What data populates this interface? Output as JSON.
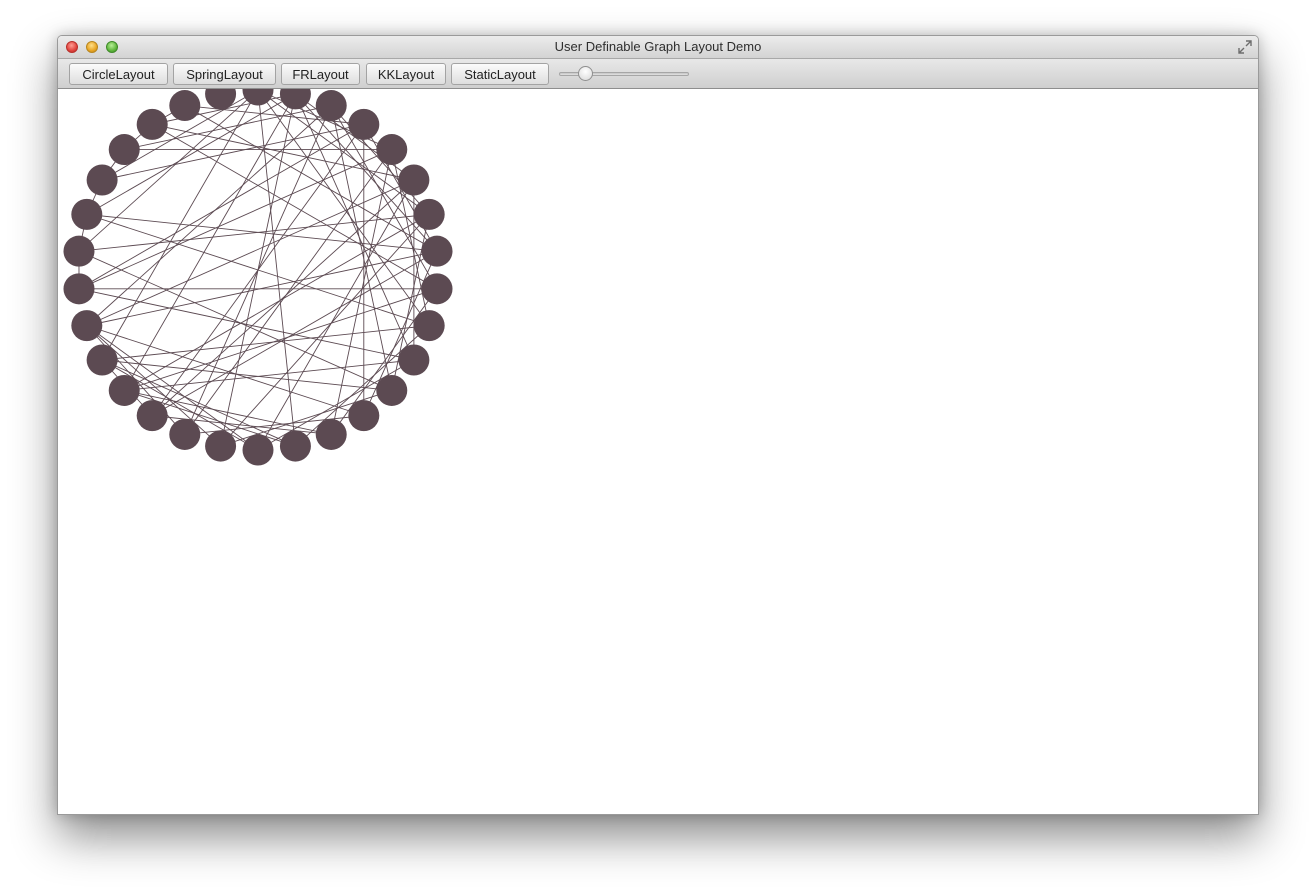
{
  "window": {
    "title": "User Definable Graph Layout Demo"
  },
  "toolbar": {
    "buttons": [
      {
        "label": "CircleLayout"
      },
      {
        "label": "SpringLayout"
      },
      {
        "label": "FRLayout"
      },
      {
        "label": "KKLayout"
      },
      {
        "label": "StaticLayout"
      }
    ],
    "slider": {
      "value": 0.2
    }
  },
  "graph": {
    "node_color": "#5c4a52",
    "edge_color": "#5c4a52",
    "node_count": 30,
    "edges": [
      [
        0,
        4
      ],
      [
        0,
        6
      ],
      [
        0,
        9
      ],
      [
        0,
        14
      ],
      [
        0,
        20
      ],
      [
        0,
        23
      ],
      [
        0,
        25
      ],
      [
        1,
        5
      ],
      [
        1,
        7
      ],
      [
        1,
        10
      ],
      [
        1,
        16
      ],
      [
        1,
        19
      ],
      [
        1,
        24
      ],
      [
        1,
        27
      ],
      [
        2,
        6
      ],
      [
        2,
        8
      ],
      [
        2,
        11
      ],
      [
        2,
        17
      ],
      [
        2,
        21
      ],
      [
        2,
        26
      ],
      [
        3,
        7
      ],
      [
        3,
        12
      ],
      [
        3,
        18
      ],
      [
        3,
        22
      ],
      [
        3,
        25
      ],
      [
        3,
        28
      ],
      [
        4,
        9
      ],
      [
        4,
        13
      ],
      [
        4,
        17
      ],
      [
        4,
        22
      ],
      [
        4,
        26
      ],
      [
        5,
        10
      ],
      [
        5,
        15
      ],
      [
        5,
        18
      ],
      [
        5,
        21
      ],
      [
        5,
        27
      ],
      [
        6,
        11
      ],
      [
        6,
        16
      ],
      [
        6,
        19
      ],
      [
        6,
        23
      ],
      [
        7,
        12
      ],
      [
        7,
        18
      ],
      [
        7,
        21
      ],
      [
        7,
        24
      ],
      [
        7,
        28
      ],
      [
        8,
        13
      ],
      [
        8,
        19
      ],
      [
        8,
        22
      ],
      [
        8,
        27
      ],
      [
        9,
        14
      ],
      [
        9,
        20
      ],
      [
        9,
        24
      ],
      [
        10,
        15
      ],
      [
        10,
        19
      ],
      [
        10,
        22
      ],
      [
        11,
        16
      ],
      [
        11,
        20
      ],
      [
        11,
        23
      ],
      [
        12,
        17
      ],
      [
        12,
        21
      ],
      [
        13,
        18
      ],
      [
        13,
        19
      ],
      [
        14,
        19
      ],
      [
        14,
        20
      ],
      [
        15,
        20
      ],
      [
        15,
        21
      ],
      [
        16,
        21
      ],
      [
        17,
        21
      ],
      [
        18,
        20
      ],
      [
        22,
        23
      ],
      [
        23,
        24
      ],
      [
        24,
        25
      ],
      [
        25,
        26
      ],
      [
        26,
        27
      ],
      [
        27,
        28
      ]
    ]
  }
}
